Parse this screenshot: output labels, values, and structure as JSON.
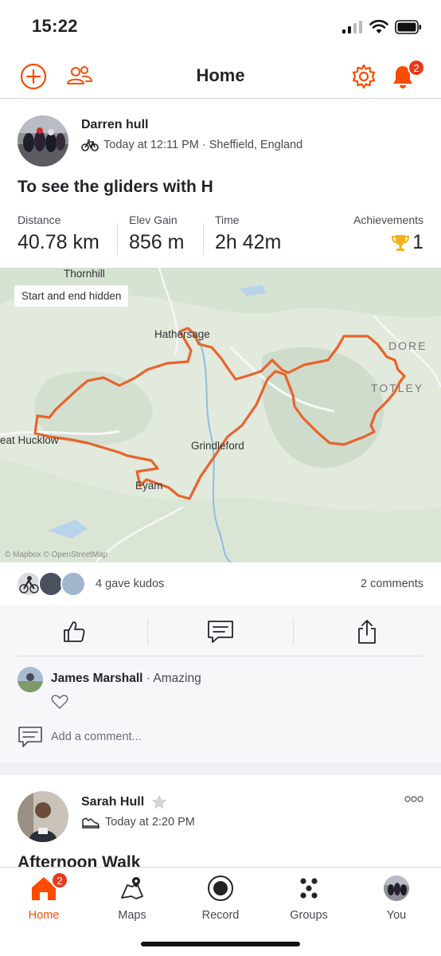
{
  "status_bar": {
    "time": "15:22"
  },
  "header": {
    "title": "Home",
    "notification_count": "2"
  },
  "activity": {
    "athlete_name": "Darren hull",
    "meta": "Today at 12:11 PM · Sheffield, England",
    "title": "To see the gliders with H",
    "stats": [
      {
        "label": "Distance",
        "value": "40.78 km"
      },
      {
        "label": "Elev Gain",
        "value": "856 m"
      },
      {
        "label": "Time",
        "value": "2h 42m"
      },
      {
        "label": "Achievements",
        "value": "1"
      }
    ],
    "map": {
      "privacy_chip": "Start and end hidden",
      "labels": {
        "thornhill": "Thornhill",
        "hathersage": "Hathersage",
        "dore": "DORE",
        "totley": "TOTLEY",
        "great_hucklow": "eat Hucklow",
        "grindleford": "Grindleford",
        "eyam": "Eyam"
      },
      "attribution": "© Mapbox © OpenStreetMap"
    },
    "kudos_text": "4 gave kudos",
    "comments_count": "2 comments",
    "comment": {
      "author": "James Marshall",
      "text": "· Amazing"
    },
    "add_comment_placeholder": "Add a comment..."
  },
  "next_activity": {
    "athlete_name": "Sarah Hull",
    "meta": "Today at 2:20 PM",
    "title": "Afternoon Walk"
  },
  "tab_bar": {
    "home_badge": "2",
    "tabs": [
      "Home",
      "Maps",
      "Record",
      "Groups",
      "You"
    ]
  },
  "colors": {
    "brand": "#fc4c02",
    "badge": "#e8391c",
    "route": "#e8642c",
    "trophy": "#f2b01e"
  },
  "icons": [
    "plus-circle-icon",
    "people-icon",
    "gear-icon",
    "bell-icon",
    "bike-icon",
    "trophy-icon",
    "thumbs-up-icon",
    "comment-icon",
    "share-icon",
    "heart-icon",
    "star-icon",
    "shoe-icon",
    "more-icon",
    "home-icon",
    "map-icon",
    "record-icon",
    "groups-icon"
  ]
}
